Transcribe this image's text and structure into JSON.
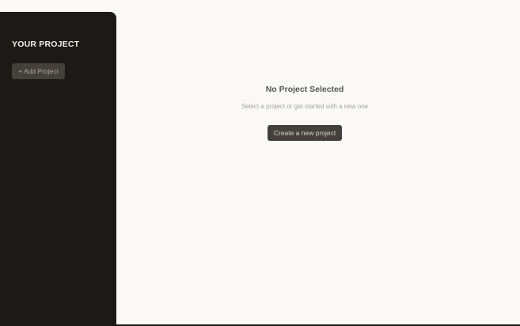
{
  "sidebar": {
    "title": "YOUR PROJECT",
    "add_button_label": "+ Add Project"
  },
  "main": {
    "empty_title": "No Project Selected",
    "empty_subtitle": "Select a project or get started with a new one",
    "create_button_label": "Create a new project"
  },
  "colors": {
    "sidebar_bg": "#1c1916",
    "main_bg": "#faf9f8",
    "button_bg": "#44403c"
  }
}
